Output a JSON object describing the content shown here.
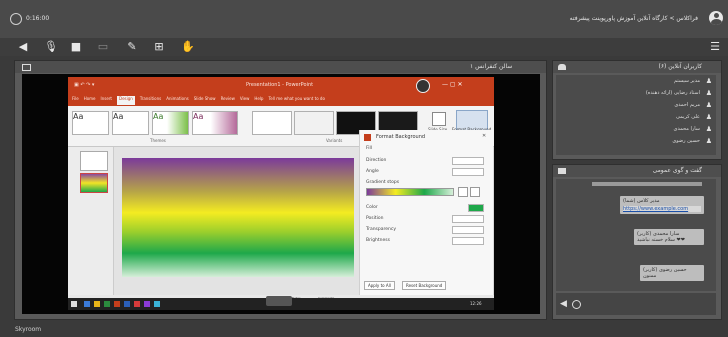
{
  "topbar": {
    "timer": "0:16:00",
    "breadcrumb": "فراکلاس > کارگاه آنلاین آموزش پاورپوینت پیشرفته"
  },
  "presentation_panel": {
    "title": "سالن کنفرانس ۱"
  },
  "ppt": {
    "window_title": "Presentation1 - PowerPoint",
    "tabs": [
      "File",
      "Home",
      "Insert",
      "Design",
      "Transitions",
      "Animations",
      "Slide Show",
      "Review",
      "View",
      "Help",
      "Tell me what you want to do"
    ],
    "variants_label": "Variants",
    "themes_label": "Themes",
    "customize_label": "Customize",
    "slide_size_label": "Slide Size",
    "format_bg_button": "Format Background",
    "pane_title": "Format Background",
    "pane_fields": [
      "Fill",
      "Direction",
      "Angle",
      "Gradient stops",
      "Color",
      "Position",
      "Transparency",
      "Brightness"
    ],
    "apply_all_button": "Apply to All",
    "reset_button": "Reset Background",
    "notes_label": "Notes",
    "comments_label": "Comments",
    "taskbar_time": "12:26"
  },
  "users_panel": {
    "title": "کاربران آنلاین (۶)",
    "users": [
      "مدیر سیستم",
      "استاد رضایی (ارائه دهنده)",
      "مریم احمدی",
      "علی کریمی",
      "سارا محمدی",
      "حسین رضوی"
    ]
  },
  "chat_panel": {
    "title": "گفت و گوی عمومی",
    "messages": [
      {
        "sender": "مدیر کلاس (شما)",
        "link": "https://www.example.com"
      },
      {
        "sender": "سارا محمدی (کاربر)",
        "text": "سلام خسته نباشید ❤❤"
      },
      {
        "sender": "حسین رضوی (کاربر)",
        "text": "ممنون"
      }
    ]
  },
  "footer": {
    "brand": "Skyroom"
  },
  "colors": {
    "ppt_accent": "#c43e1c",
    "panel_bg": "#5a5a5a",
    "topbar_bg": "#4a4a4a"
  }
}
